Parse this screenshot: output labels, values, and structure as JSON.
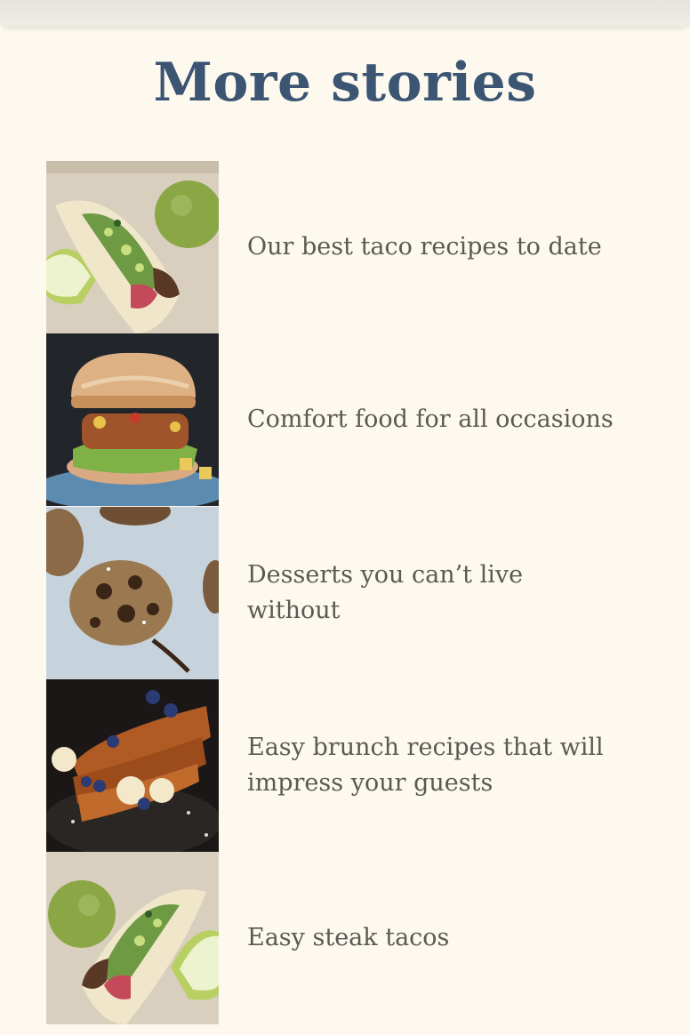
{
  "page": {
    "section_title": "More stories"
  },
  "stories": [
    {
      "title": "Our best taco recipes to date"
    },
    {
      "title": "Comfort food for all occasions"
    },
    {
      "title": "Desserts you can’t live without"
    },
    {
      "title": "Easy brunch recipes that will impress your guests"
    },
    {
      "title": "Easy steak tacos"
    }
  ],
  "colors": {
    "background": "#fdf9ee",
    "title": "#3b5573",
    "story_text": "#5b5955"
  }
}
